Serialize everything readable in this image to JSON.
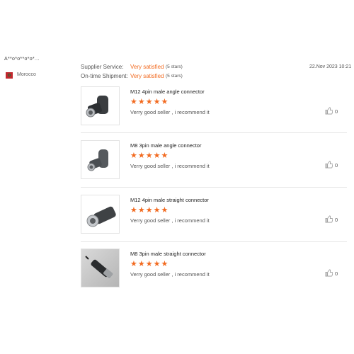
{
  "reviewer": {
    "name": "A**o*o**o*o*...",
    "country": "Morocco"
  },
  "summary": {
    "supplier_label": "Supplier Service:",
    "supplier_rating": "Very satisfied",
    "supplier_stars": "(5 stars)",
    "shipment_label": "On-time Shipment:",
    "shipment_rating": "Very satisfied",
    "shipment_stars": "(5 stars)",
    "date": "22.Nov 2023 10:21"
  },
  "items": [
    {
      "title": "M12 4pin male angle connector",
      "stars": "★★★★★",
      "comment": "Verry good seller , i recommend it",
      "likes": "0"
    },
    {
      "title": "M8 3pin male angle connector",
      "stars": "★★★★★",
      "comment": "Verry good seller , i recommend it",
      "likes": "0"
    },
    {
      "title": "M12 4pin male straight connector",
      "stars": "★★★★★",
      "comment": "Verry good seller , i recommend it",
      "likes": "0"
    },
    {
      "title": "M8 3pin male straight connector",
      "stars": "★★★★★",
      "comment": "Verry good seller , i recommend it",
      "likes": "0"
    }
  ],
  "colors": {
    "accent": "#f26b21",
    "flag_red": "#c1272d"
  },
  "icons": {
    "like": "thumbs-up-icon",
    "flag": "morocco-flag-icon"
  }
}
